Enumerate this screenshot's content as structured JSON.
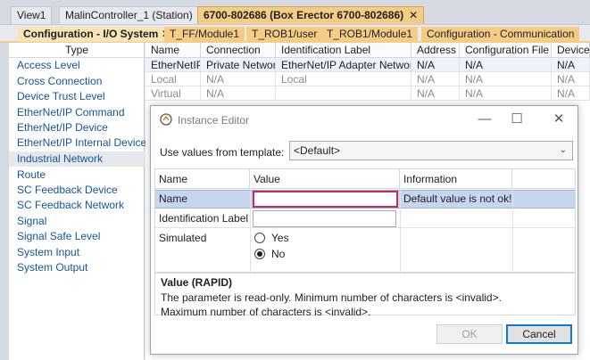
{
  "doc_tabs": [
    {
      "label": "View1"
    },
    {
      "label": "MalinController_1 (Station)"
    },
    {
      "label": "6700-802686 (Box Erector 6700-802686)",
      "close": "✕"
    }
  ],
  "sub_tabs": [
    {
      "label": "Configuration - I/O System",
      "close": "✕"
    },
    {
      "label": "T_FF/Module1"
    },
    {
      "label": "T_ROB1/user"
    },
    {
      "label": "T_ROB1/Module1"
    },
    {
      "label": "Configuration - Communication"
    }
  ],
  "type_panel": {
    "header": "Type",
    "items": [
      "Access Level",
      "Cross Connection",
      "Device Trust Level",
      "EtherNet/IP Command",
      "EtherNet/IP Device",
      "EtherNet/IP Internal Device",
      "Industrial Network",
      "Route",
      "SC Feedback Device",
      "SC Feedback Network",
      "Signal",
      "Signal Safe Level",
      "System Input",
      "System Output"
    ],
    "selected": "Industrial Network"
  },
  "grid": {
    "columns": [
      "Name",
      "Connection",
      "Identification Label",
      "Address",
      "Configuration File",
      "Device"
    ],
    "rows": [
      [
        "EtherNetIP",
        "Private Network",
        "EtherNet/IP Adapter Network",
        "N/A",
        "N/A",
        "N/A"
      ],
      [
        "Local",
        "N/A",
        "Local",
        "N/A",
        "N/A",
        "N/A"
      ],
      [
        "Virtual",
        "N/A",
        "",
        "N/A",
        "N/A",
        "N/A"
      ]
    ]
  },
  "dialog": {
    "title": "Instance Editor",
    "minimize": "—",
    "maximize": "☐",
    "close": "✕",
    "template_label": "Use values from template:",
    "template_value": "<Default>",
    "param_columns": [
      "Name",
      "Value",
      "Information"
    ],
    "params": {
      "name_label": "Name",
      "name_value": "",
      "name_info": "Default value is not ok!",
      "ident_label": "Identification Label",
      "ident_value": "",
      "sim_label": "Simulated",
      "sim_yes": "Yes",
      "sim_no": "No",
      "sim_selected": "No"
    },
    "help_title": "Value (RAPID)",
    "help_line1": "The parameter is read-only. Minimum number of characters is <invalid>.",
    "help_line2": "Maximum number of characters is <invalid>.",
    "ok_label": "OK",
    "cancel_label": "Cancel"
  },
  "colors": {
    "active_tab": "#f5cc84",
    "link_text": "#14549c",
    "error_border": "#c42b5f",
    "selection": "#c7d6ee",
    "focus_border": "#0f78d7"
  }
}
